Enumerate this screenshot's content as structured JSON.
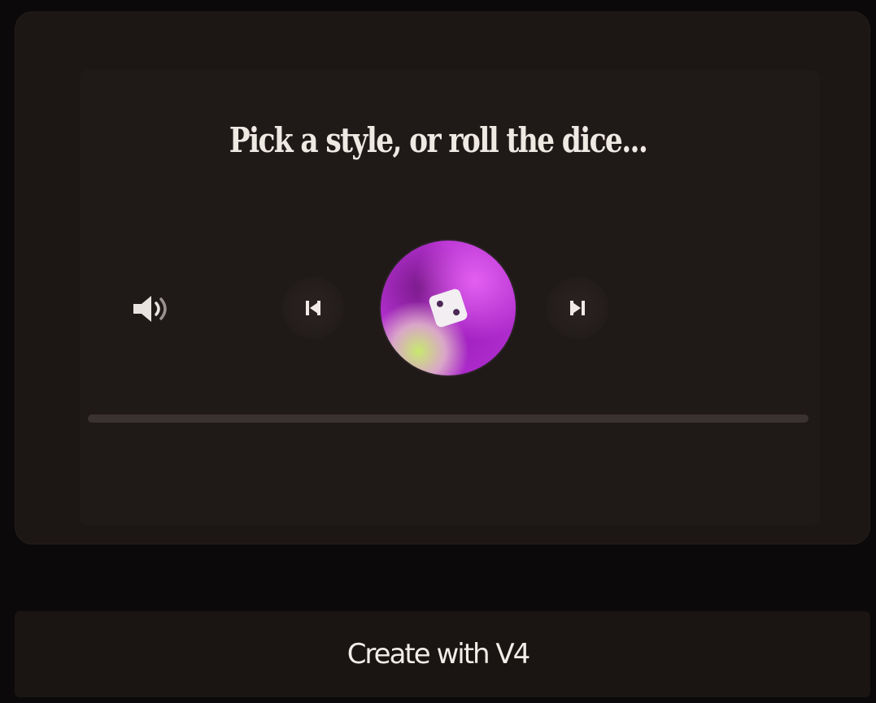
{
  "player": {
    "prompt": "Pick a style, or roll the dice...",
    "progress": 0.0,
    "icons": {
      "volume": "volume-icon",
      "previous": "skip-previous-icon",
      "dice": "dice-icon",
      "next": "skip-next-icon"
    },
    "colors": {
      "background": "#0b0909",
      "card": "#1c1615",
      "accent": "#b330d0",
      "text": "#efe9e4"
    }
  },
  "footer": {
    "create_label": "Create with V4"
  }
}
